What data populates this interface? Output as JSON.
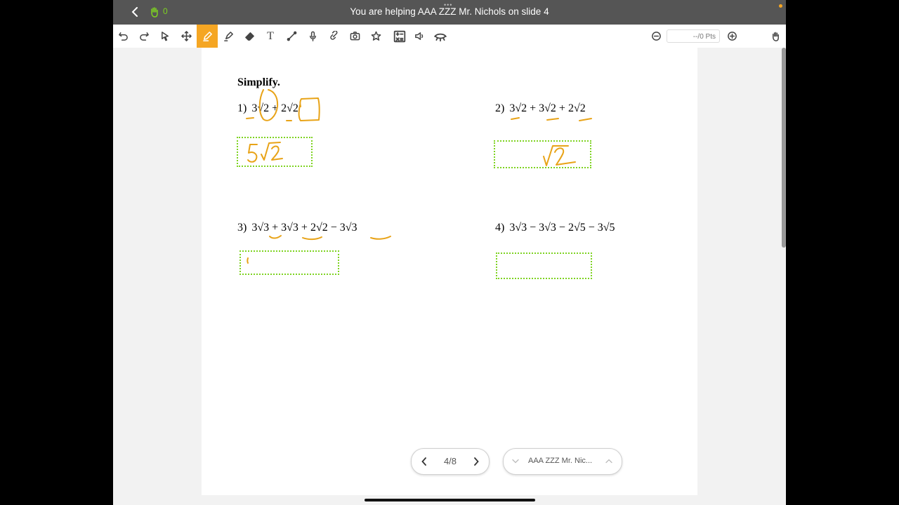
{
  "topbar": {
    "title": "You are helping AAA ZZZ Mr. Nichols on slide 4",
    "hand_count": "0",
    "dots": "•••"
  },
  "toolbar": {
    "tools": [
      {
        "name": "undo-icon",
        "active": false
      },
      {
        "name": "redo-icon",
        "active": false
      },
      {
        "name": "select-icon",
        "active": false
      },
      {
        "name": "move-icon",
        "active": false
      },
      {
        "name": "pen-icon",
        "active": true
      },
      {
        "name": "highlighter-icon",
        "active": false
      },
      {
        "name": "eraser-icon",
        "active": false
      },
      {
        "name": "text-icon",
        "active": false
      },
      {
        "name": "line-icon",
        "active": false
      },
      {
        "name": "microphone-icon",
        "active": false
      },
      {
        "name": "link-icon",
        "active": false
      },
      {
        "name": "camera-icon",
        "active": false
      },
      {
        "name": "star-icon",
        "active": false
      },
      {
        "name": "calculator-icon",
        "active": false
      },
      {
        "name": "speaker-icon",
        "active": false
      },
      {
        "name": "hide-icon",
        "active": false
      }
    ],
    "points": "--/0 Pts",
    "text_tool_glyph": "T"
  },
  "worksheet": {
    "heading": "Simplify.",
    "problems": [
      {
        "number": "1)",
        "expression": "3√2 + 2√2"
      },
      {
        "number": "2)",
        "expression": "3√2 + 3√2 + 2√2"
      },
      {
        "number": "3)",
        "expression": "3√3 + 3√3 + 2√2 − 3√3"
      },
      {
        "number": "4)",
        "expression": "3√3 − 3√3 − 2√5 − 3√5"
      }
    ]
  },
  "pager": {
    "label": "4/8"
  },
  "student_selector": {
    "label": "AAA ZZZ Mr. Nic..."
  },
  "colors": {
    "ink": "#e8a317",
    "answer_box": "#7ed321",
    "active_tool": "#f5a623",
    "topbar": "#555555"
  }
}
